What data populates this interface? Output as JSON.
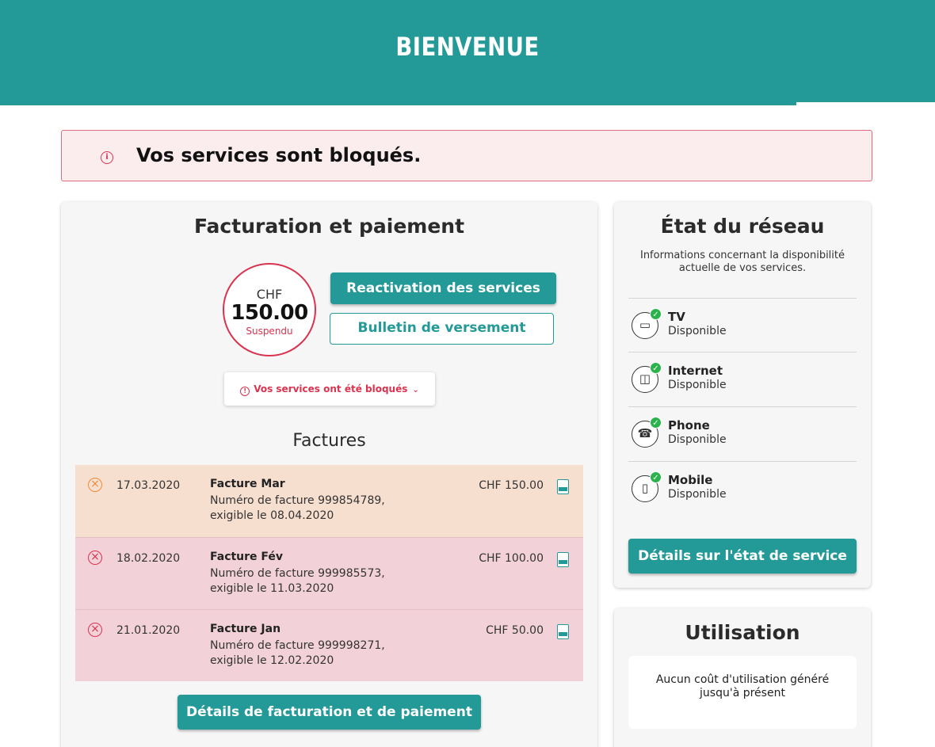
{
  "header": {
    "title": "BIENVENUE",
    "color": "#249a98"
  },
  "alert": {
    "icon": "info-icon",
    "message": "Vos services sont bloqués."
  },
  "billing": {
    "title": "Facturation et paiement",
    "currency": "CHF",
    "amount": "150.00",
    "status": "Suspendu",
    "reactivate_label": "Reactivation des services",
    "bulletin_label": "Bulletin de versement",
    "blocked_notice": "Vos services ont été bloqués",
    "invoices_title": "Factures",
    "invoices": [
      {
        "date": "17.03.2020",
        "title": "Facture Mar",
        "line1": "Numéro de facture 999854789,",
        "line2": "exigible le 08.04.2020",
        "amount": "CHF 150.00"
      },
      {
        "date": "18.02.2020",
        "title": "Facture Fév",
        "line1": "Numéro de facture 999985573,",
        "line2": "exigible le 11.03.2020",
        "amount": "CHF 100.00"
      },
      {
        "date": "21.01.2020",
        "title": "Facture Jan",
        "line1": "Numéro de facture 999998271,",
        "line2": "exigible le 12.02.2020",
        "amount": "CHF 50.00"
      }
    ],
    "details_label": "Détails de facturation et de paiement"
  },
  "network": {
    "title": "État du réseau",
    "subtitle": "Informations concernant la disponibilité actuelle de vos services.",
    "services": [
      {
        "name": "TV",
        "status": "Disponible",
        "icon": "tv-icon"
      },
      {
        "name": "Internet",
        "status": "Disponible",
        "icon": "internet-icon"
      },
      {
        "name": "Phone",
        "status": "Disponible",
        "icon": "phone-icon"
      },
      {
        "name": "Mobile",
        "status": "Disponible",
        "icon": "mobile-icon"
      }
    ],
    "details_label": "Détails sur l'état de service"
  },
  "usage": {
    "title": "Utilisation",
    "message": "Aucun coût d'utilisation généré jusqu'à présent"
  },
  "colors": {
    "accent": "#249a98",
    "error": "#d9334f",
    "warning": "#ef8a3a",
    "available": "#2bb34b"
  }
}
